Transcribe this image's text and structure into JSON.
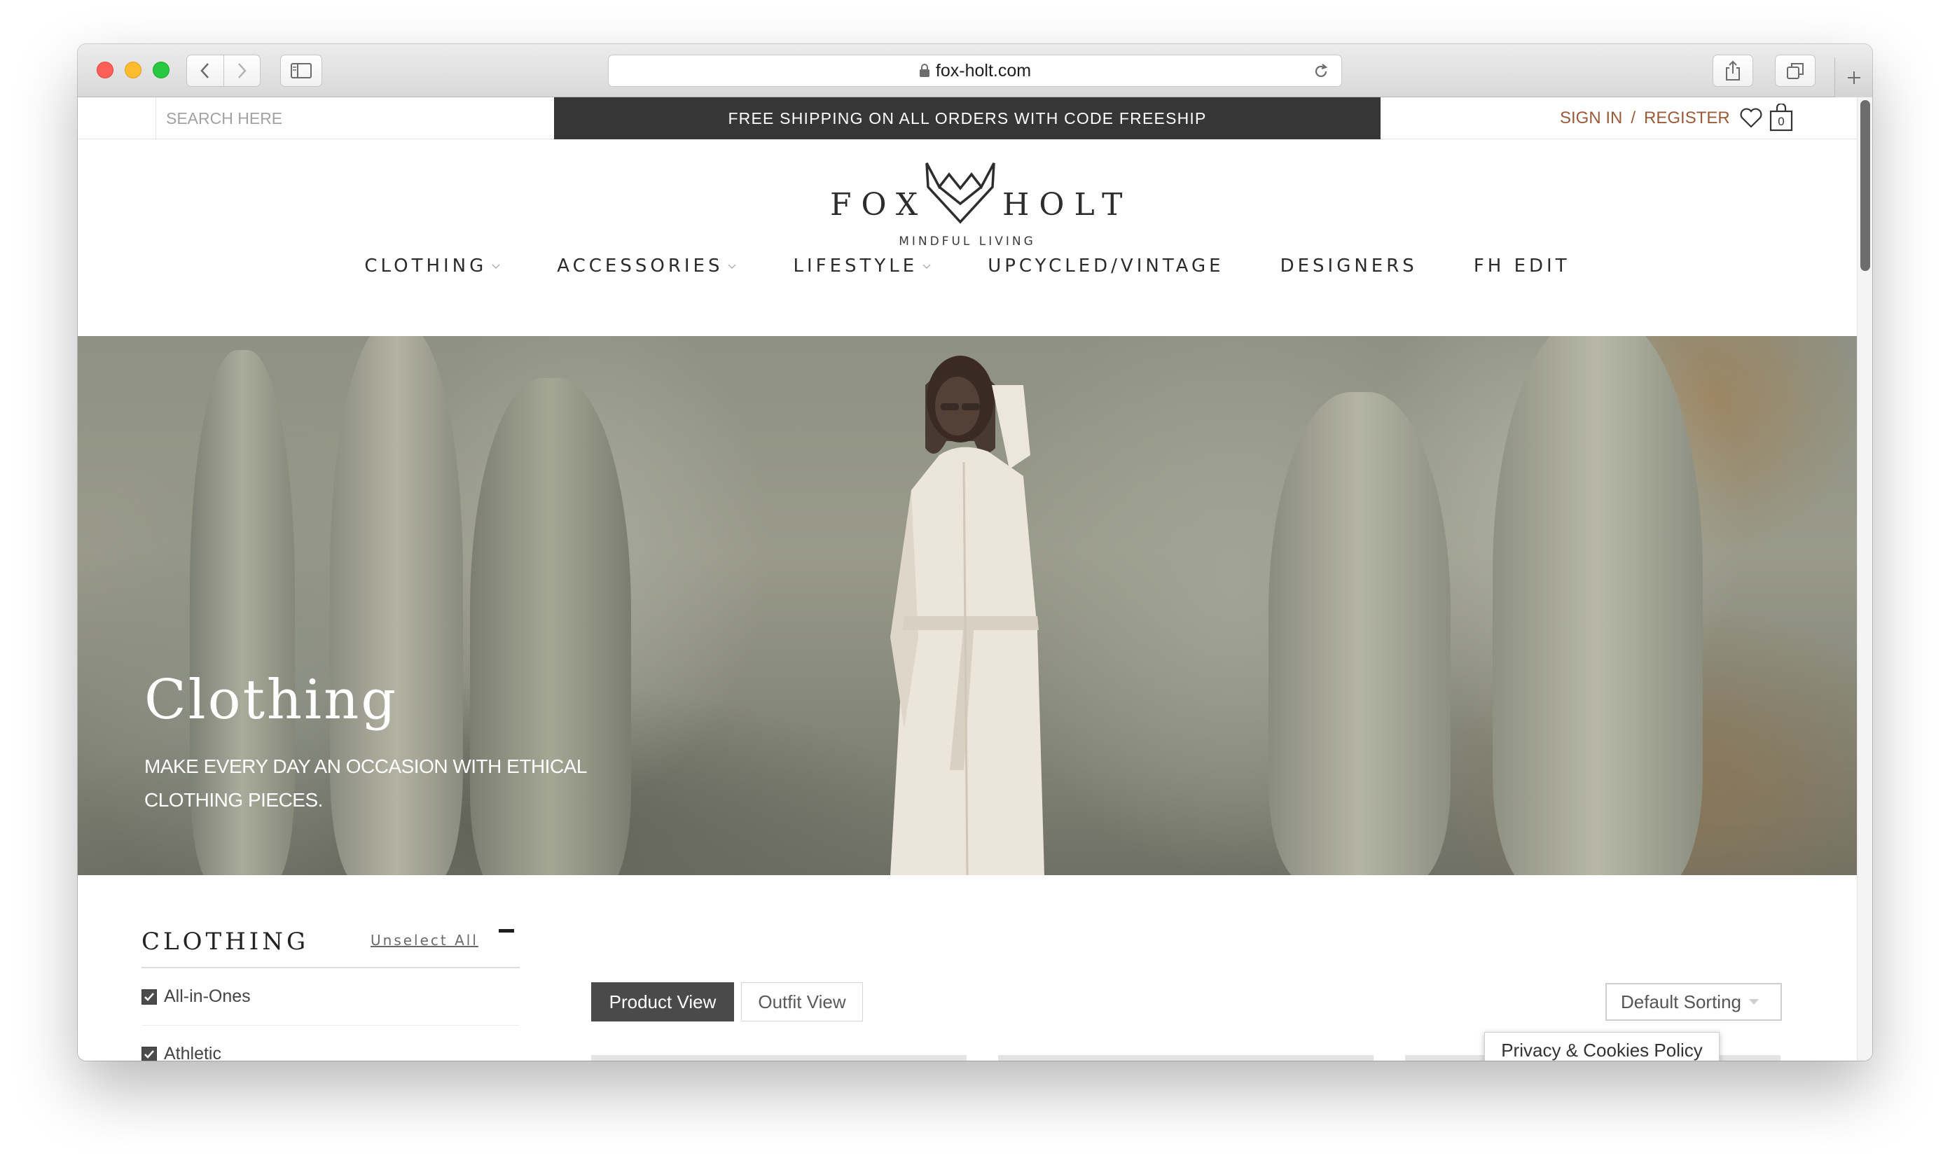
{
  "browser": {
    "url": "fox-holt.com"
  },
  "topbar": {
    "search_placeholder": "SEARCH HERE",
    "promo": "FREE SHIPPING ON ALL ORDERS WITH CODE FREESHIP",
    "sign_in": "SIGN IN",
    "separator": "/",
    "register": "REGISTER",
    "cart_count": "0"
  },
  "logo": {
    "left_word": "FOX",
    "right_word": "HOLT",
    "tagline": "MINDFUL LIVING"
  },
  "nav": {
    "items": [
      {
        "label": "CLOTHING",
        "has_dropdown": true
      },
      {
        "label": "ACCESSORIES",
        "has_dropdown": true
      },
      {
        "label": "LIFESTYLE",
        "has_dropdown": true
      },
      {
        "label": "UPCYCLED/VINTAGE",
        "has_dropdown": false
      },
      {
        "label": "DESIGNERS",
        "has_dropdown": false
      },
      {
        "label": "FH EDIT",
        "has_dropdown": false
      }
    ]
  },
  "hero": {
    "title": "Clothing",
    "subtitle": "MAKE EVERY DAY AN OCCASION WITH ETHICAL CLOTHING PIECES."
  },
  "filter": {
    "title": "CLOTHING",
    "unselect_all": "Unselect All",
    "items": [
      {
        "label": "All-in-Ones",
        "checked": true
      },
      {
        "label": "Athletic",
        "checked": true
      }
    ]
  },
  "view": {
    "product_view": "Product View",
    "outfit_view": "Outfit View"
  },
  "sorting": {
    "selected": "Default Sorting"
  },
  "privacy": {
    "label": "Privacy & Cookies Policy"
  },
  "colors": {
    "promo_bg": "#363636",
    "account_link": "#9a5b3a",
    "active_toggle": "#4a4a4a"
  }
}
